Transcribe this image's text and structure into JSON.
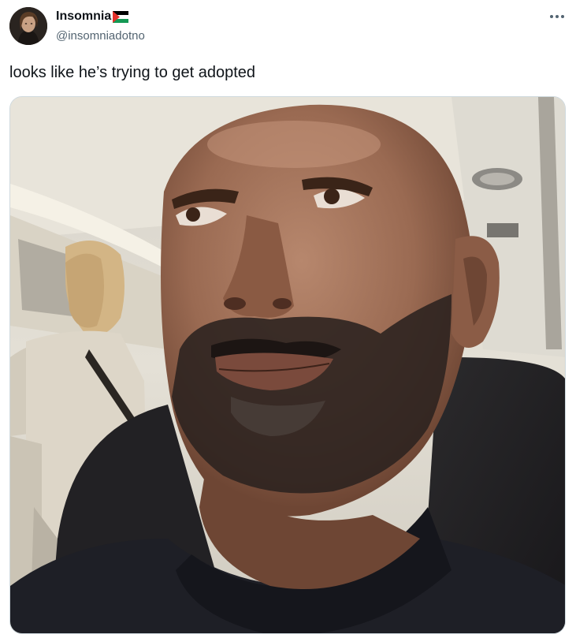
{
  "author": {
    "display_name": "Insomnia",
    "handle": "@insomniadotno",
    "avatar_icon": "profile-avatar",
    "name_emoji": "palestine-flag-icon"
  },
  "tweet": {
    "text": "looks like he’s trying to get adopted"
  },
  "more_menu": {
    "icon": "more-horizontal-icon"
  },
  "media": {
    "type": "photo",
    "alt": ""
  },
  "colors": {
    "text_primary": "#0f1419",
    "text_secondary": "#536471",
    "border": "#cfd9de"
  }
}
